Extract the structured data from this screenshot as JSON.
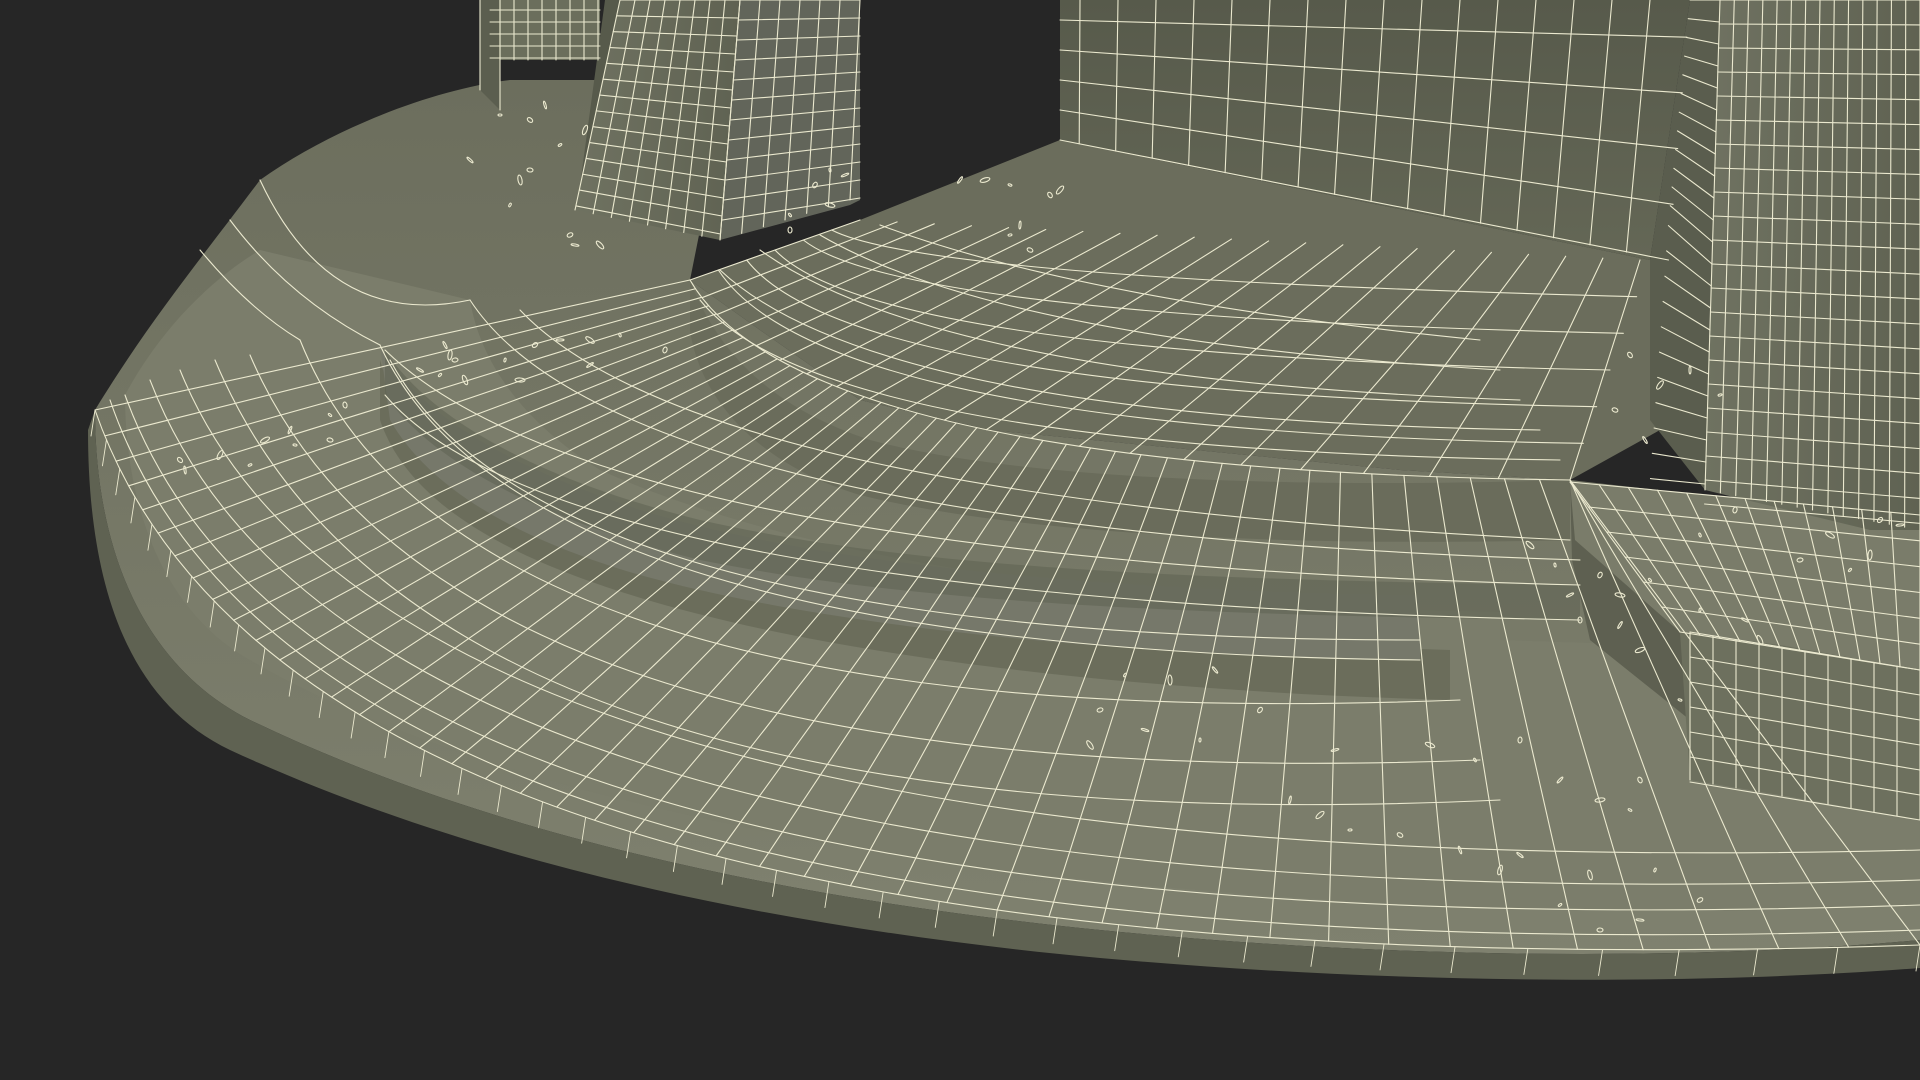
{
  "scene": {
    "subject": "wireframe-render-3d-model",
    "colors": {
      "background": "#262626",
      "surface_top": "#7c7e6c",
      "surface_riser": "#6f725f",
      "surface_shadow": "#5e6051",
      "wall": "#5f6252",
      "wire": "#ebe9cf"
    }
  }
}
